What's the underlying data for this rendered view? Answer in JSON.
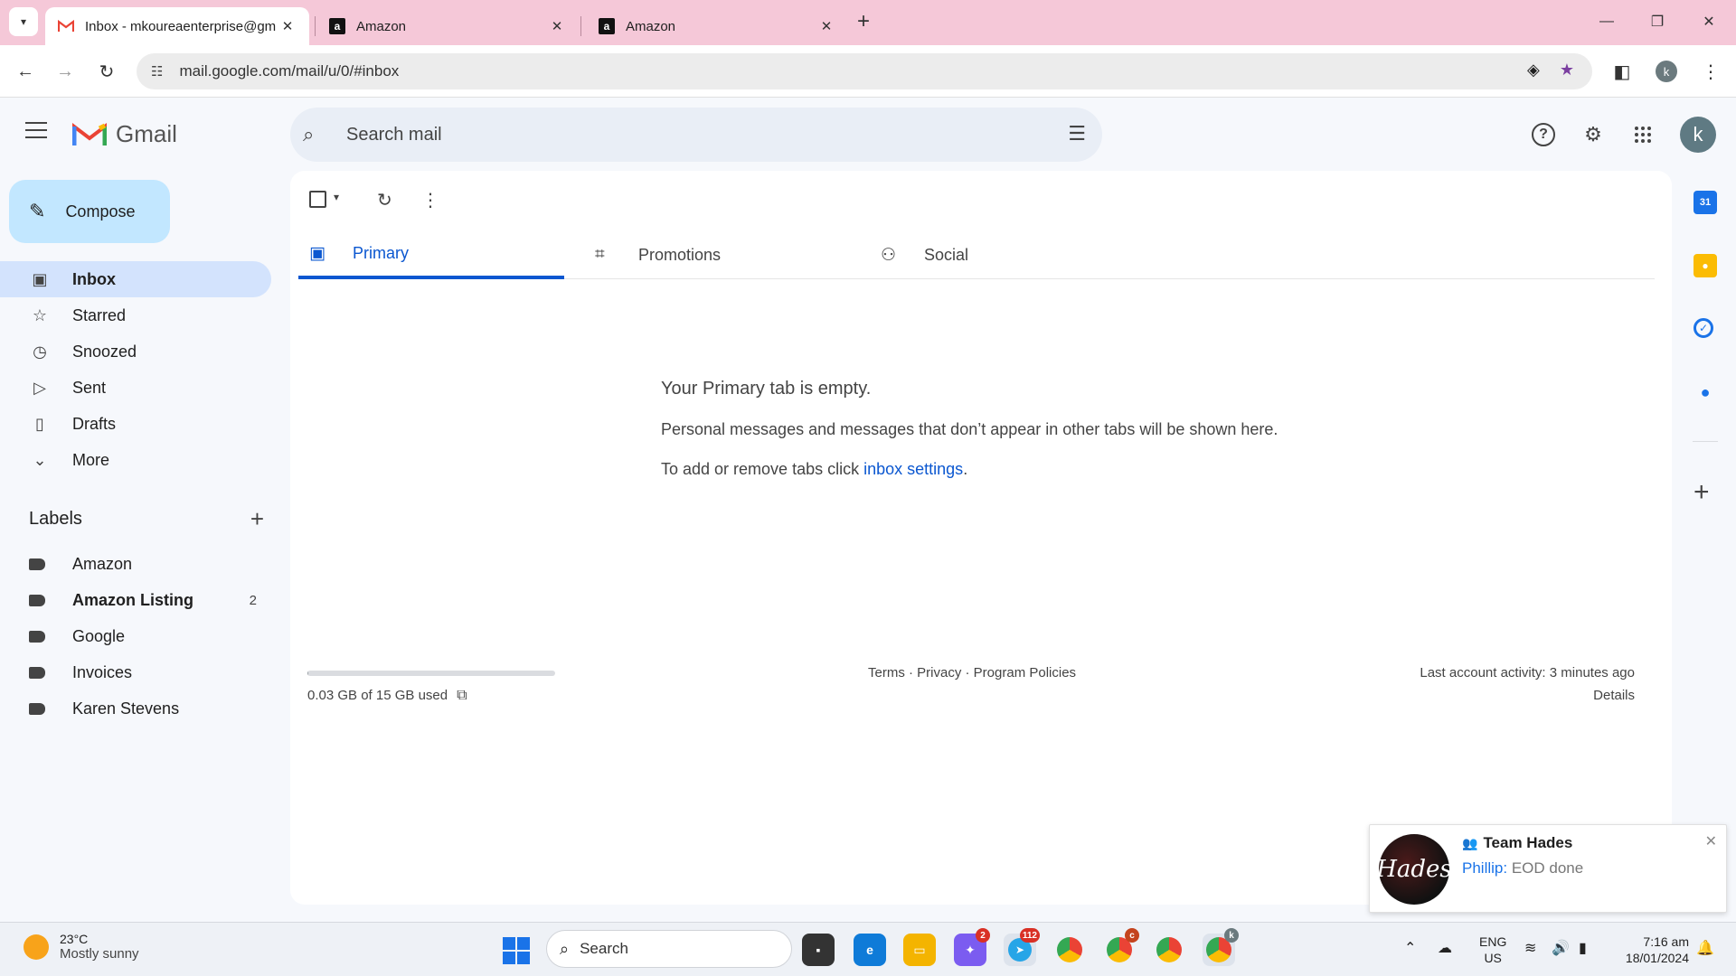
{
  "browser": {
    "tabs": [
      {
        "title": "Inbox - mkoureaenterprise@gm",
        "favicon": "gmail-icon",
        "active": true
      },
      {
        "title": "Amazon",
        "favicon": "amazon-icon",
        "active": false
      },
      {
        "title": "Amazon",
        "favicon": "amazon-icon",
        "active": false
      }
    ],
    "url": "mail.google.com/mail/u/0/#inbox",
    "profile_initial": "k"
  },
  "gmail": {
    "brand": "Gmail",
    "search_placeholder": "Search mail",
    "user_initial": "k",
    "compose_label": "Compose",
    "nav": [
      {
        "label": "Inbox",
        "icon": "inbox-icon",
        "active": true
      },
      {
        "label": "Starred",
        "icon": "star-icon"
      },
      {
        "label": "Snoozed",
        "icon": "clock-icon"
      },
      {
        "label": "Sent",
        "icon": "send-icon"
      },
      {
        "label": "Drafts",
        "icon": "draft-icon"
      },
      {
        "label": "More",
        "icon": "chevron-down-icon"
      }
    ],
    "labels_title": "Labels",
    "labels": [
      {
        "name": "Amazon",
        "count": ""
      },
      {
        "name": "Amazon Listing",
        "count": "2",
        "bold": true
      },
      {
        "name": "Google",
        "count": ""
      },
      {
        "name": "Invoices",
        "count": ""
      },
      {
        "name": "Karen Stevens",
        "count": ""
      }
    ],
    "inbox_tabs": [
      {
        "label": "Primary",
        "icon": "inbox-icon",
        "active": true
      },
      {
        "label": "Promotions",
        "icon": "tag-icon"
      },
      {
        "label": "Social",
        "icon": "people-icon"
      }
    ],
    "empty": {
      "title": "Your Primary tab is empty.",
      "subtitle": "Personal messages and messages that don’t appear in other tabs will be shown here.",
      "settings_prefix": "To add or remove tabs click ",
      "settings_link": "inbox settings",
      "settings_suffix": "."
    },
    "footer": {
      "storage": "0.03 GB of 15 GB used",
      "storage_fraction": 0.002,
      "links": "Terms · Privacy · Program Policies",
      "last_activity": "Last account activity: 3 minutes ago",
      "details": "Details"
    }
  },
  "notification": {
    "group": "Team Hades",
    "sender": "Phillip:",
    "message": "EOD done",
    "avatar_text": "Hades"
  },
  "taskbar": {
    "weather_temp": "23°C",
    "weather_desc": "Mostly sunny",
    "search_placeholder": "Search",
    "messenger_badge": "2",
    "telegram_badge": "112",
    "chrome_badge_c": "c",
    "chrome_badge_k": "k",
    "lang_top": "ENG",
    "lang_bottom": "US",
    "time": "7:16 am",
    "date": "18/01/2024"
  }
}
